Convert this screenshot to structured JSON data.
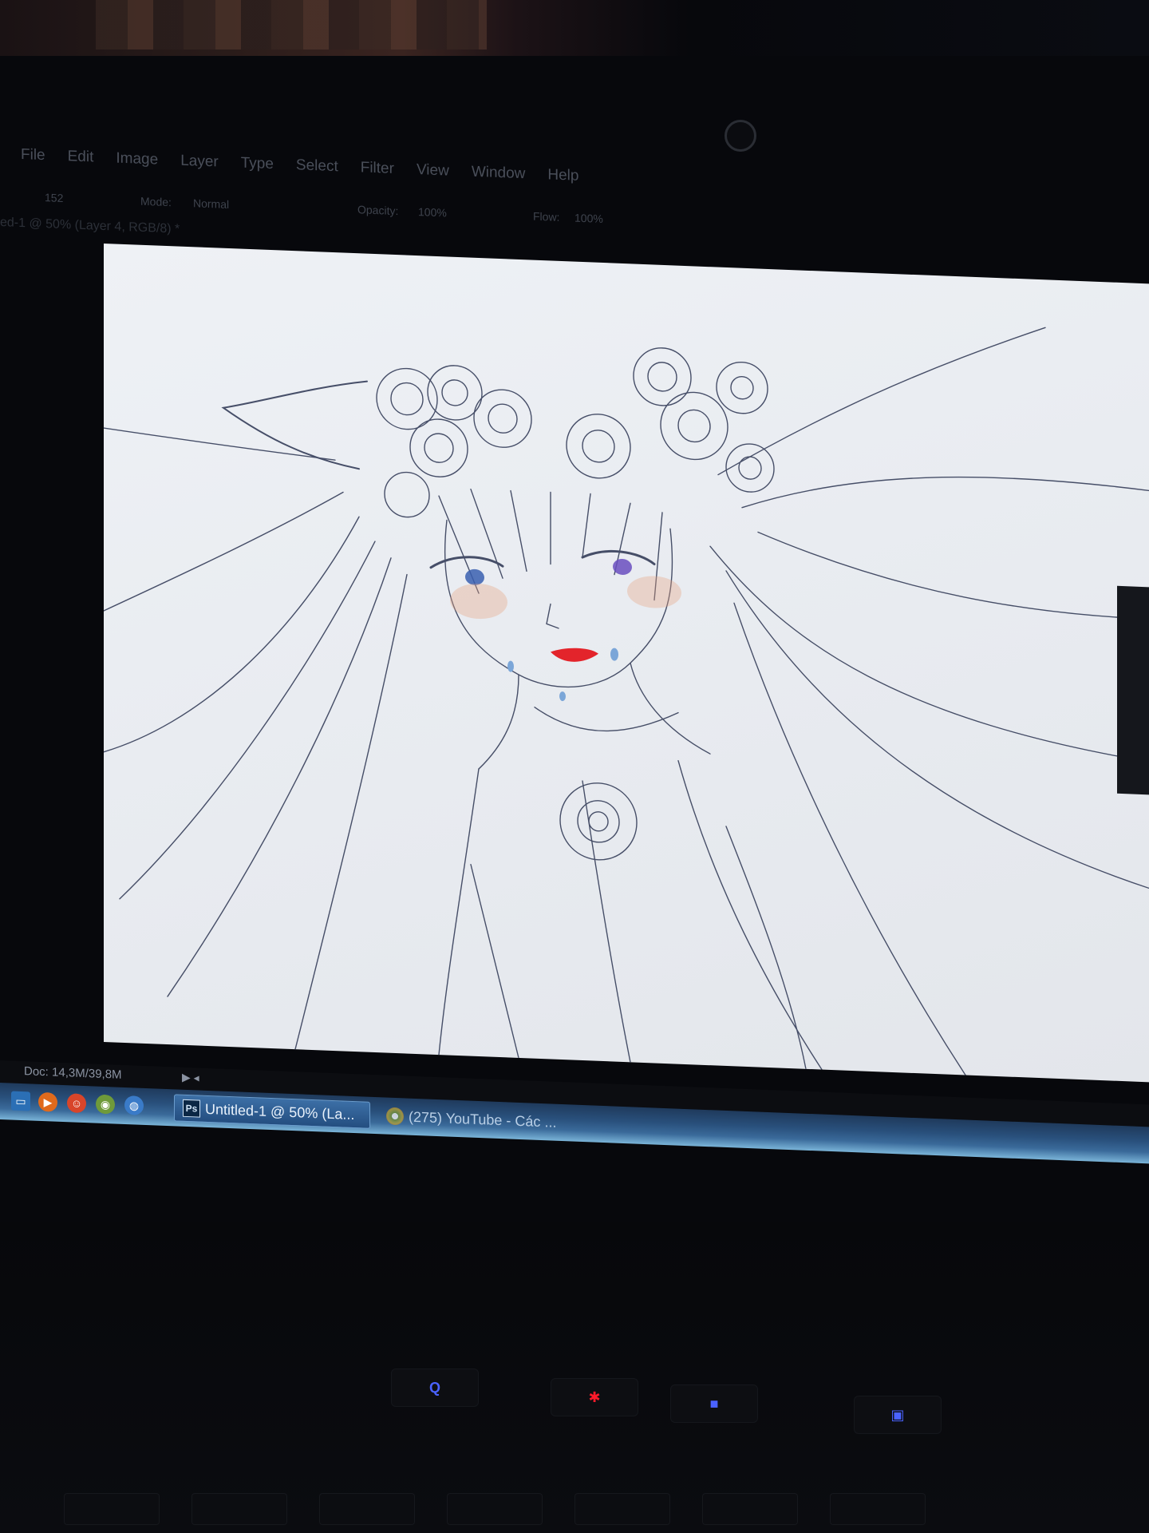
{
  "menu": [
    "File",
    "Edit",
    "Image",
    "Layer",
    "Type",
    "Select",
    "Filter",
    "View",
    "Window",
    "Help"
  ],
  "options_bar": {
    "brush_size": "152",
    "mode_label": "Mode:",
    "mode_value": "Normal",
    "opacity_label": "Opacity:",
    "opacity_value": "100%",
    "flow_label": "Flow:",
    "flow_value": "100%"
  },
  "document_tab": "ed-1 @ 50% (Layer 4, RGB/8) *",
  "status": {
    "doc_size": "Doc: 14,3M/39,8M"
  },
  "taskbar": {
    "items": [
      {
        "label": "Untitled-1 @ 50% (La..."
      },
      {
        "label": "(275) YouTube - Các ..."
      }
    ]
  },
  "hardware_buttons": [
    "Q"
  ],
  "colors": {
    "taskbar_start": "#1f3a5c",
    "taskbar_end": "#7ab4d8",
    "canvas_bg": "#eef1f5",
    "hw_led_blue": "#4a62ff",
    "hw_led_red": "#ff1a2a"
  }
}
